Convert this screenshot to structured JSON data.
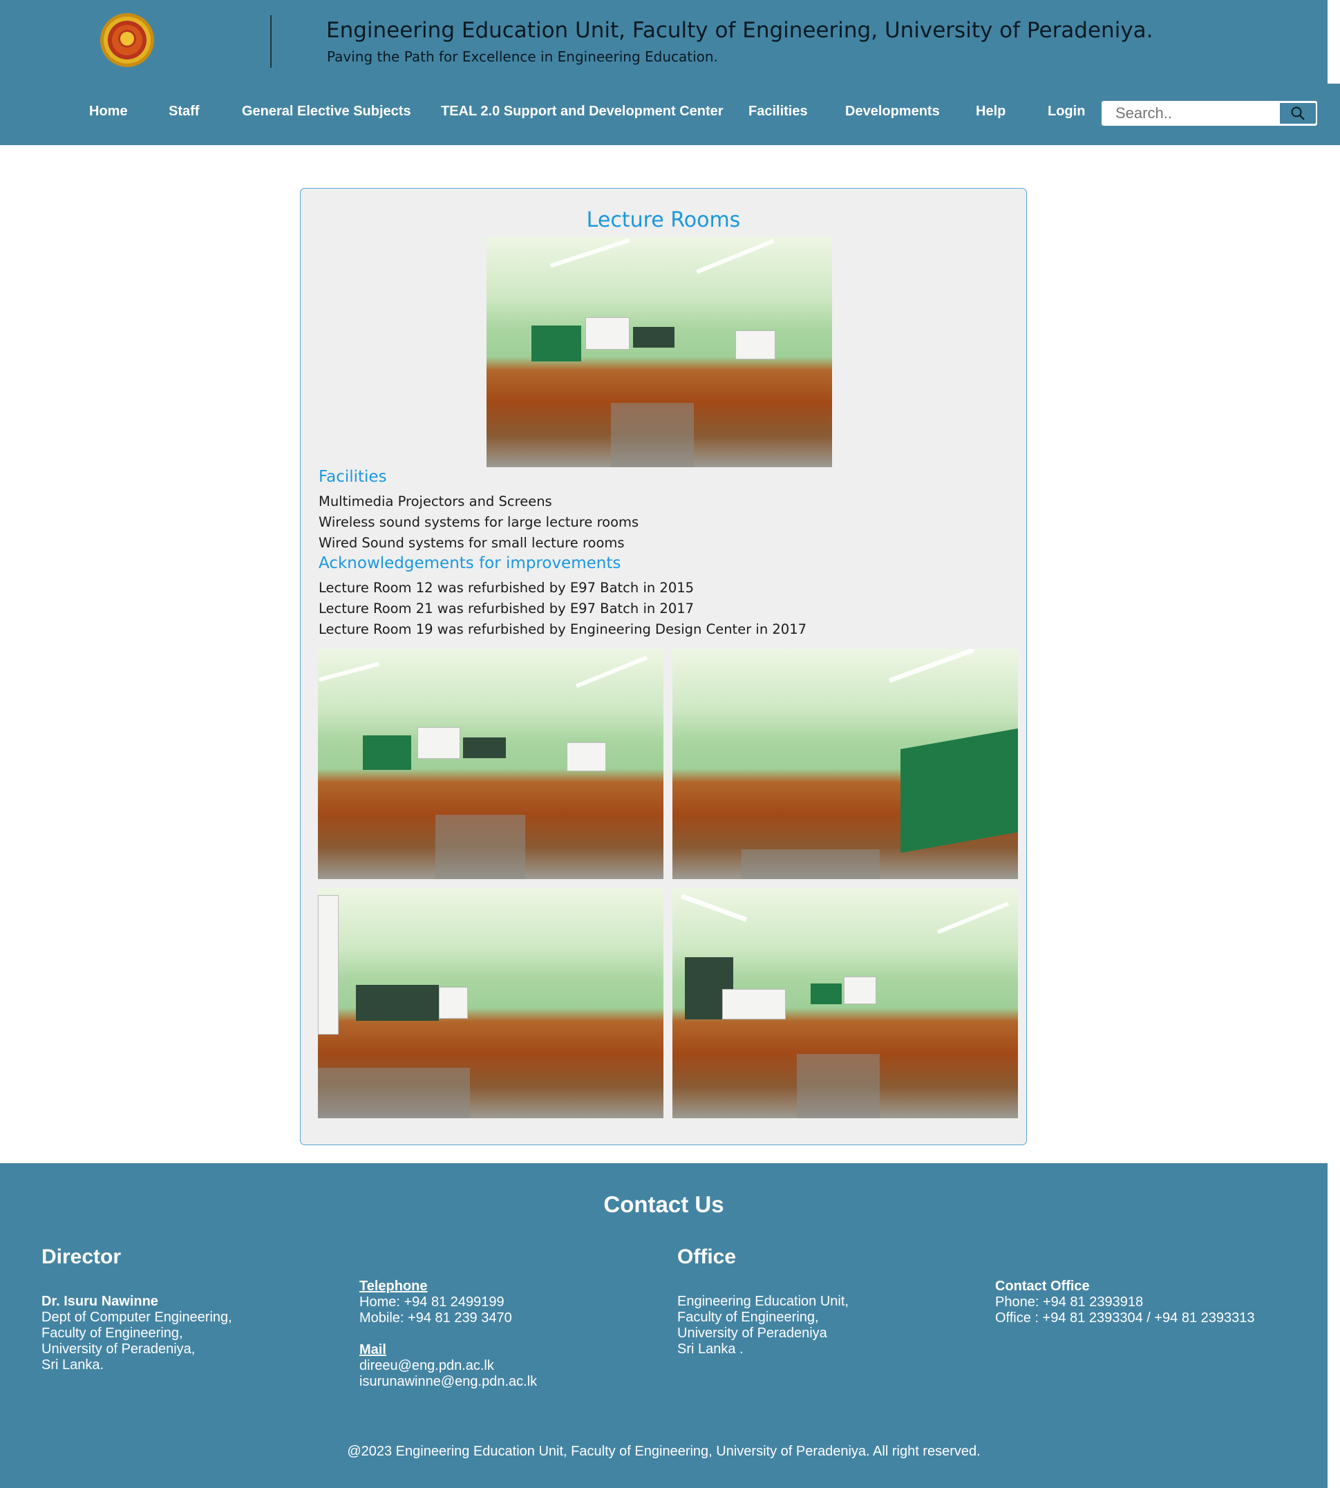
{
  "header": {
    "title": "Engineering Education Unit, Faculty of Engineering, University of Peradeniya.",
    "subtitle": "Paving the Path for Excellence in Engineering Education.",
    "logo_icon": "university-crest-icon"
  },
  "nav": {
    "items": [
      {
        "label": "Home"
      },
      {
        "label": "Staff"
      },
      {
        "label": "General Elective Subjects"
      },
      {
        "label": "TEAL 2.0 Support and Development Center"
      },
      {
        "label": "Facilities"
      },
      {
        "label": "Developments"
      },
      {
        "label": "Help"
      },
      {
        "label": "Login"
      }
    ],
    "search_placeholder": "Search.."
  },
  "main": {
    "title": "Lecture Rooms",
    "facilities_heading": "Facilities",
    "facilities": [
      "Multimedia Projectors and Screens",
      "Wireless sound systems for large lecture rooms",
      "Wired Sound systems for small lecture rooms"
    ],
    "ack_heading": "Acknowledgements for improvements",
    "acknowledgements": [
      "Lecture Room 12 was refurbished by E97 Batch in 2015",
      "Lecture Room 21 was refurbished by E97 Batch in 2017",
      "Lecture Room 19 was refurbished by Engineering Design Center in 2017"
    ]
  },
  "footer": {
    "contact_title": "Contact Us",
    "director_heading": "Director",
    "director_name": "Dr. Isuru Nawinne",
    "director_lines": [
      "Dept of Computer Engineering,",
      "Faculty of Engineering,",
      "University of Peradeniya,",
      "Sri Lanka."
    ],
    "telephone_label": "Telephone",
    "telephone_lines": [
      "Home: +94 81 2499199",
      "Mobile: +94 81 239 3470"
    ],
    "mail_label": "Mail",
    "mail_lines": [
      "direeu@eng.pdn.ac.lk",
      "isurunawinne@eng.pdn.ac.lk"
    ],
    "office_heading": "Office",
    "office_lines": [
      "Engineering Education Unit,",
      "Faculty of Engineering,",
      "University of Peradeniya",
      "Sri Lanka ."
    ],
    "contact_office_label": "Contact Office",
    "contact_office_lines": [
      "Phone: +94 81 2393918",
      "Office : +94 81 2393304 / +94 81 2393313"
    ],
    "copyright": "@2023 Engineering Education Unit, Faculty of Engineering, University of Peradeniya. All right reserved."
  },
  "colors": {
    "header_bg": "#4484a3",
    "accent_blue": "#1a98e0",
    "panel_bg": "#efefef"
  }
}
